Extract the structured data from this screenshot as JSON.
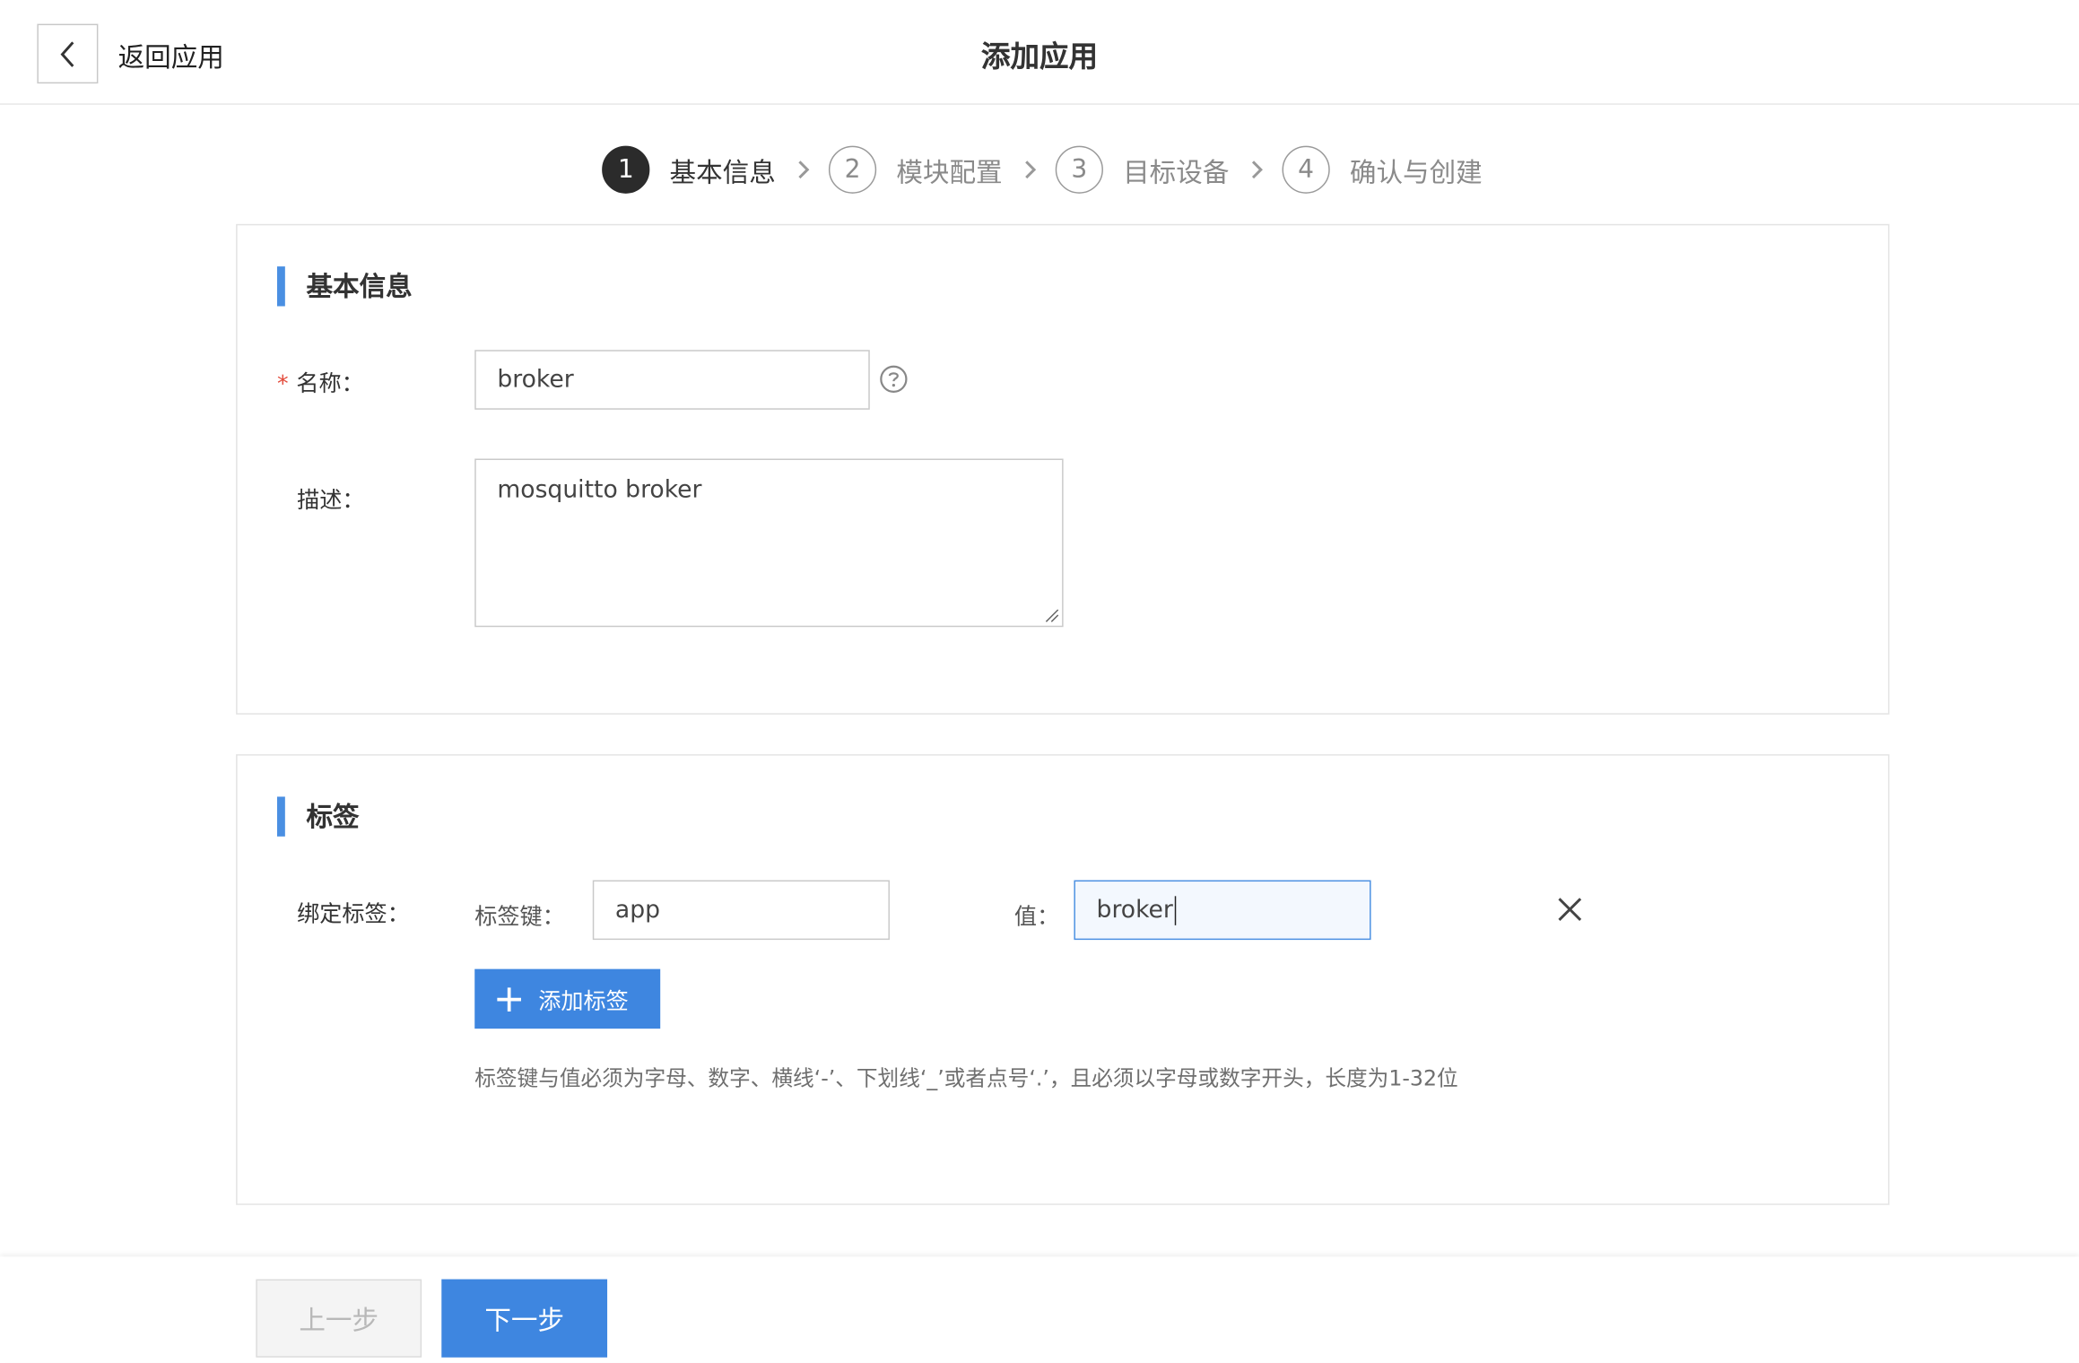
{
  "header": {
    "back_label": "返回应用",
    "title": "添加应用"
  },
  "steps": [
    {
      "number": "1",
      "label": "基本信息",
      "active": true
    },
    {
      "number": "2",
      "label": "模块配置",
      "active": false
    },
    {
      "number": "3",
      "label": "目标设备",
      "active": false
    },
    {
      "number": "4",
      "label": "确认与创建",
      "active": false
    }
  ],
  "basic_info": {
    "section_title": "基本信息",
    "name_required_mark": "*",
    "name_label": "名称：",
    "name_value": "broker",
    "description_label": "描述：",
    "description_value": "mosquitto broker"
  },
  "tags": {
    "section_title": "标签",
    "bind_label": "绑定标签：",
    "key_label": "标签键：",
    "key_value": "app",
    "value_label": "值：",
    "value_value": "broker",
    "add_button_label": "添加标签",
    "hint": "标签键与值必须为字母、数字、横线‘-’、下划线‘_’或者点号‘.’，且必须以字母或数字开头，长度为1-32位"
  },
  "footer": {
    "prev_label": "上一步",
    "next_label": "下一步"
  },
  "colors": {
    "accent": "#3e86e0",
    "required": "#e34a3a",
    "active_step": "#2b2b2b"
  }
}
